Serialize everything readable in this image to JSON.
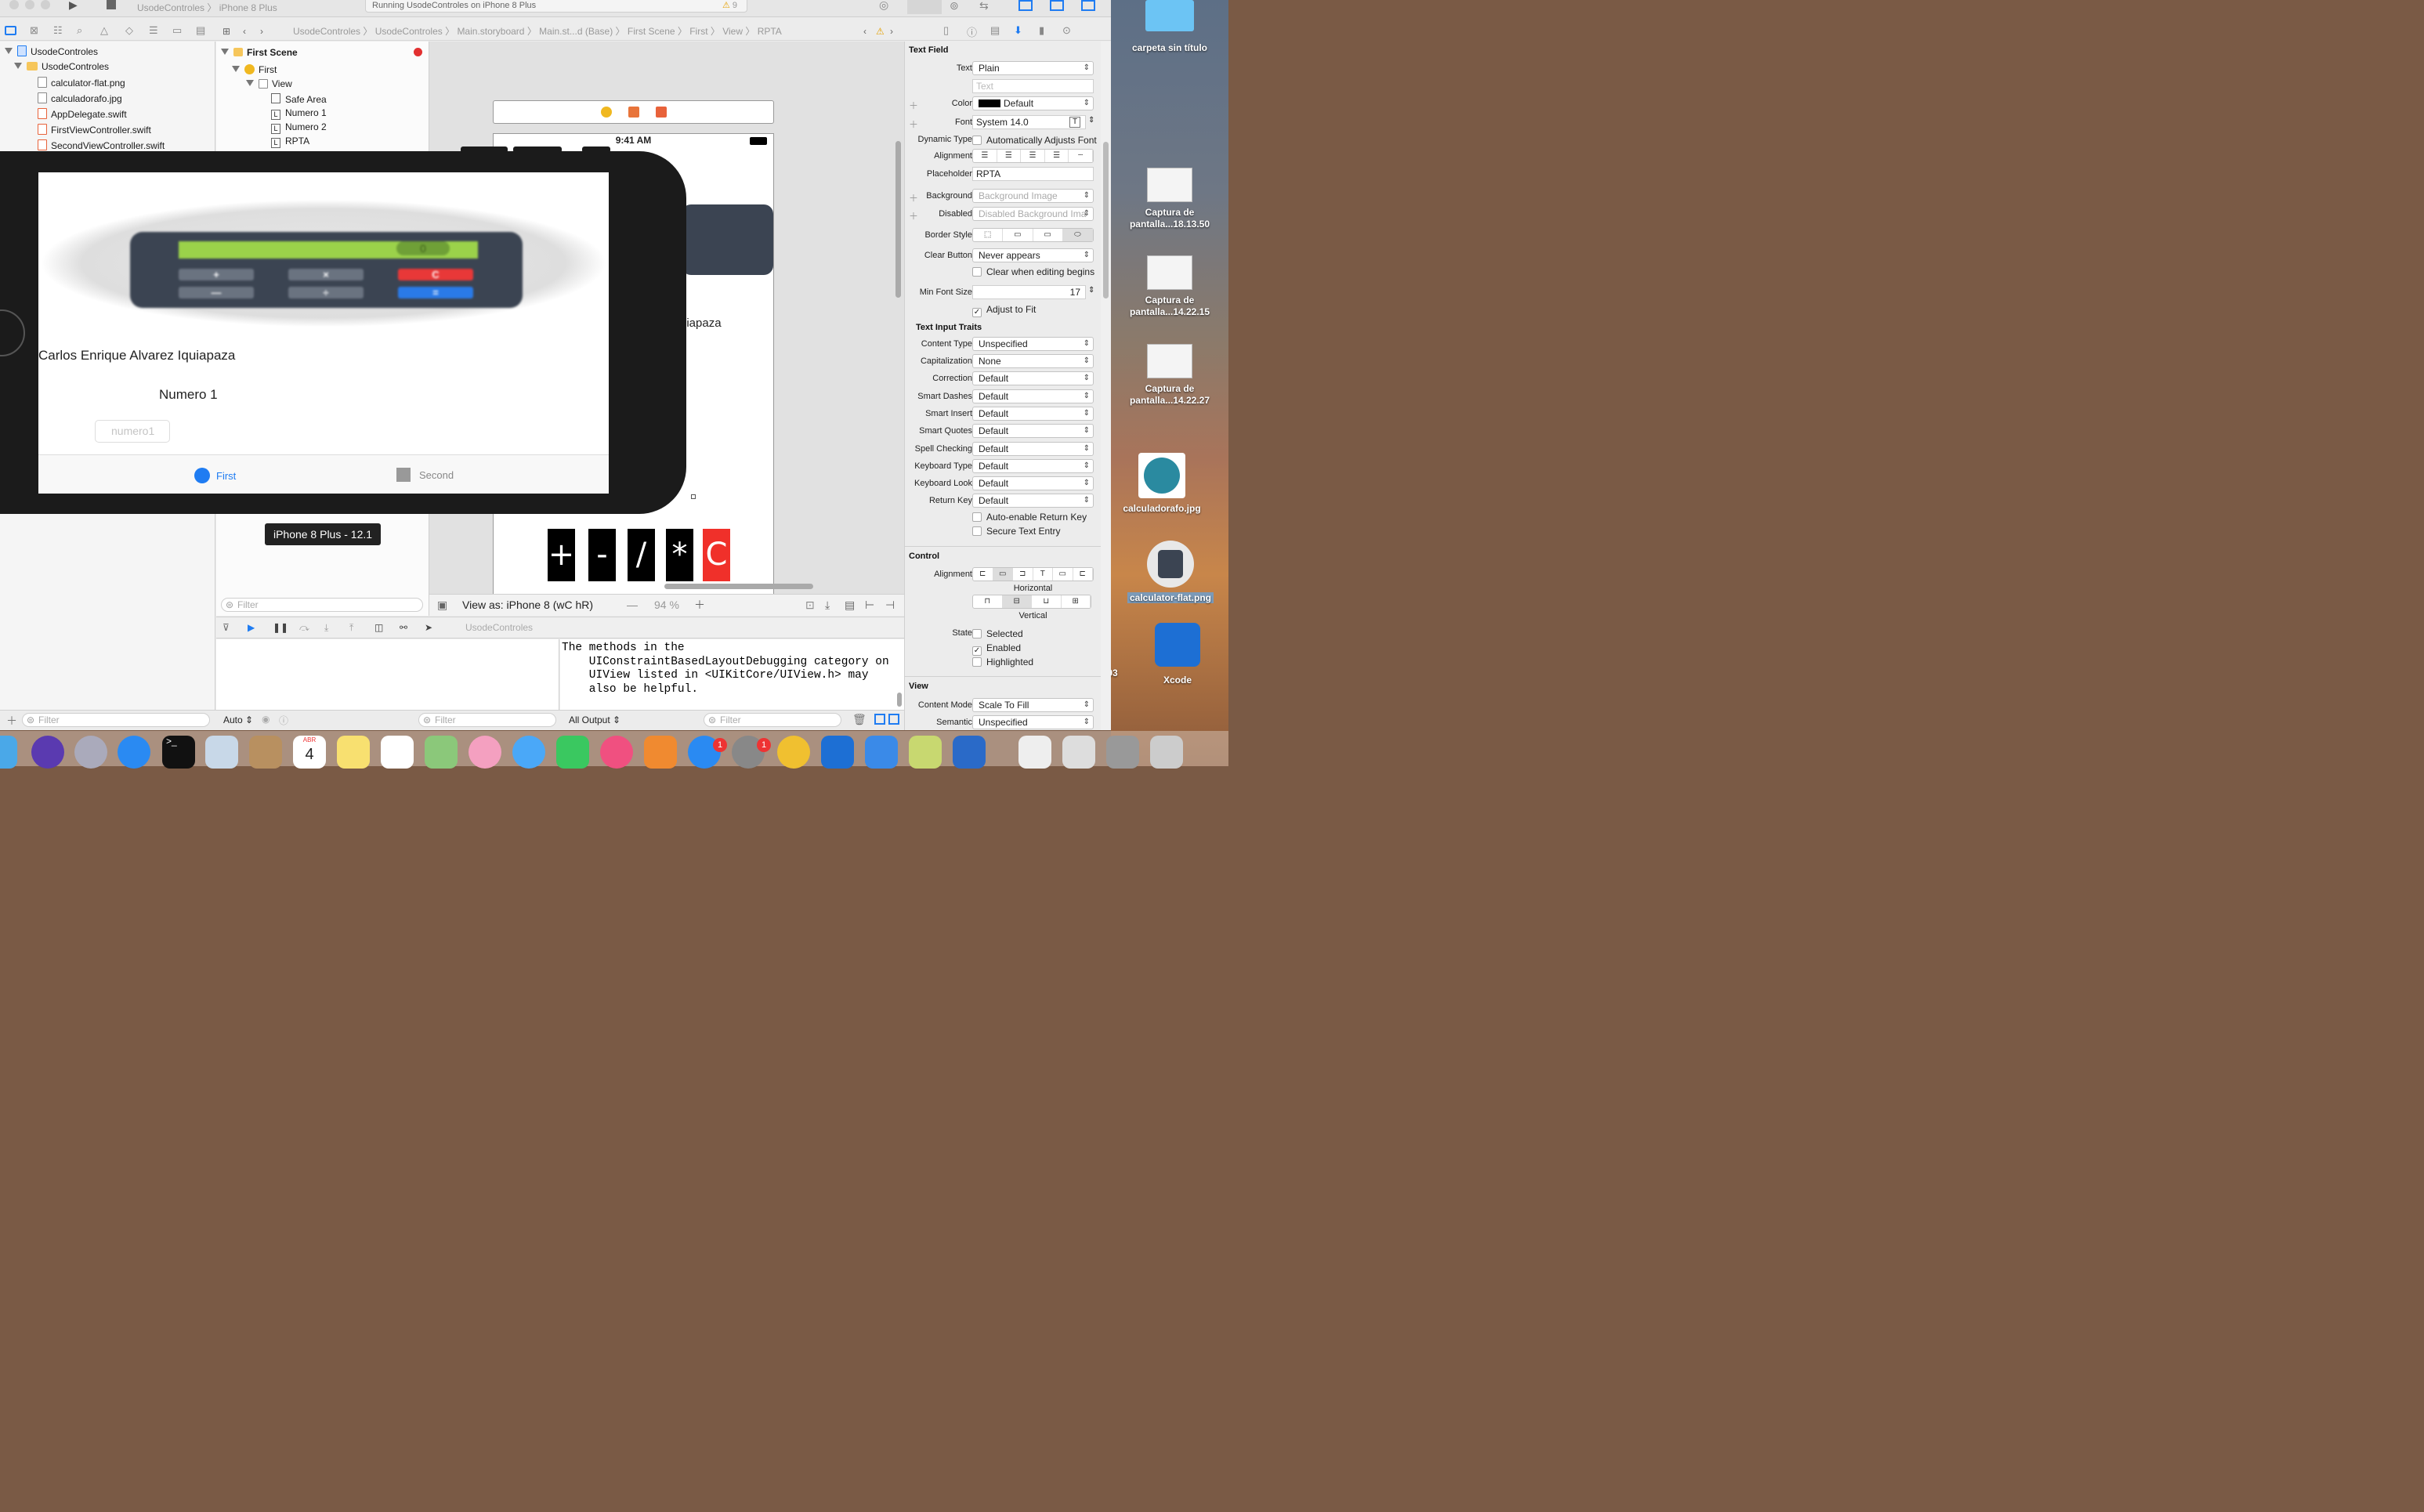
{
  "toolbar": {
    "scheme": "UsodeControles",
    "device": "iPhone 8 Plus",
    "status": "Running UsodeControles on iPhone 8 Plus",
    "warning_count": "9"
  },
  "jumpbar": {
    "path": [
      "UsodeControles",
      "UsodeControles",
      "Main.storyboard",
      "Main.st...d (Base)",
      "First Scene",
      "First",
      "View",
      "RPTA"
    ]
  },
  "navigator": {
    "project": "UsodeControles",
    "group": "UsodeControles",
    "files": [
      "calculator-flat.png",
      "calculadorafo.jpg",
      "AppDelegate.swift",
      "FirstViewController.swift",
      "SecondViewController.swift"
    ],
    "filter_placeholder": "Filter"
  },
  "outline": {
    "scene": "First Scene",
    "controller": "First",
    "view": "View",
    "children": [
      "Safe Area",
      "Numero 1",
      "Numero 2",
      "RPTA"
    ],
    "filter_placeholder": "Filter"
  },
  "canvas": {
    "time": "9:41 AM",
    "partial_label": "uiapaza",
    "keys": [
      "+",
      "-",
      "/",
      "*",
      "C"
    ],
    "view_as": "View as: iPhone 8 (wC hR)",
    "zoom": "94 %"
  },
  "simulator": {
    "name_label": "Carlos Enrique Alvarez Iquiapaza",
    "numero_label": "Numero 1",
    "field_placeholder": "numero1",
    "calc_keys": [
      "+",
      "×",
      "C",
      "—",
      "÷",
      "="
    ],
    "calc_display": "0",
    "tab_first": "First",
    "tab_second": "Second",
    "badge": "iPhone 8 Plus - 12.1"
  },
  "debug": {
    "target": "UsodeControles",
    "auto": "Auto",
    "output": "All Output",
    "console": "The methods in the\n    UIConstraintBasedLayoutDebugging category on\n    UIView listed in <UIKitCore/UIView.h> may\n    also be helpful.",
    "filter_placeholder": "Filter"
  },
  "inspector": {
    "section_textfield": "Text Field",
    "text_label": "Text",
    "text_value": "Plain",
    "text_placeholder": "Text",
    "color_label": "Color",
    "color_value": "Default",
    "font_label": "Font",
    "font_value": "System 14.0",
    "dynamic_label": "Dynamic Type",
    "dynamic_value": "Automatically Adjusts Font",
    "alignment_label": "Alignment",
    "placeholder_label": "Placeholder",
    "placeholder_value": "RPTA",
    "background_label": "Background",
    "background_value": "Background Image",
    "disabled_label": "Disabled",
    "disabled_value": "Disabled Background Ima",
    "border_label": "Border Style",
    "clear_label": "Clear Button",
    "clear_value": "Never appears",
    "clear_editing": "Clear when editing begins",
    "minfont_label": "Min Font Size",
    "minfont_value": "17",
    "adjust_fit": "Adjust to Fit",
    "section_traits": "Text Input Traits",
    "traits": [
      {
        "label": "Content Type",
        "value": "Unspecified"
      },
      {
        "label": "Capitalization",
        "value": "None"
      },
      {
        "label": "Correction",
        "value": "Default"
      },
      {
        "label": "Smart Dashes",
        "value": "Default"
      },
      {
        "label": "Smart Insert",
        "value": "Default"
      },
      {
        "label": "Smart Quotes",
        "value": "Default"
      },
      {
        "label": "Spell Checking",
        "value": "Default"
      },
      {
        "label": "Keyboard Type",
        "value": "Default"
      },
      {
        "label": "Keyboard Look",
        "value": "Default"
      },
      {
        "label": "Return Key",
        "value": "Default"
      }
    ],
    "auto_return": "Auto-enable Return Key",
    "secure": "Secure Text Entry",
    "section_control": "Control",
    "control_alignment_label": "Alignment",
    "horizontal": "Horizontal",
    "vertical": "Vertical",
    "state_label": "State",
    "state_selected": "Selected",
    "state_enabled": "Enabled",
    "state_highlighted": "Highlighted",
    "section_view": "View",
    "content_mode_label": "Content Mode",
    "content_mode_value": "Scale To Fill",
    "semantic_label": "Semantic",
    "semantic_value": "Unspecified"
  },
  "desktop": {
    "folder": "carpeta sin título",
    "shot1": "Captura de pantalla...18.13.50",
    "shot2": "Captura de pantalla...14.22.15",
    "shot3": "Captura de pantalla...14.22.27",
    "jpg": "calculadorafo.jpg",
    "png": "calculator-flat.png",
    "xcode": "Xcode",
    "partial": "03"
  },
  "dock": {
    "calendar_month": "ABR",
    "calendar_day": "4",
    "badge_appstore": "1",
    "badge_prefs": "1"
  },
  "colors": {
    "accent": "#1f7cf2",
    "clear_key": "#f0302a",
    "calc_green": "#9bd24a"
  }
}
